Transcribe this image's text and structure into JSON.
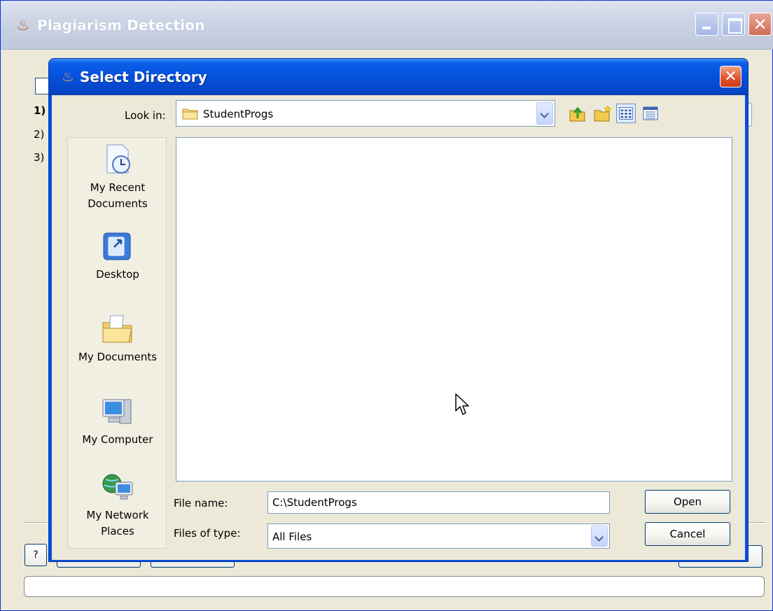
{
  "main_window": {
    "title": "Plagiarism Detection",
    "steps": [
      "1)",
      "2)",
      "3)"
    ],
    "help_label": "?"
  },
  "dialog": {
    "title": "Select Directory",
    "close_glyph": "✕",
    "look_in": {
      "label": "Look in:",
      "value": "StudentProgs"
    },
    "toolbar_icons": [
      "up-folder-icon",
      "new-folder-icon",
      "list-view-icon",
      "details-view-icon"
    ],
    "places": [
      {
        "label": "My Recent Documents",
        "line1": "My Recent",
        "line2": "Documents",
        "icon": "recent-documents-icon"
      },
      {
        "label": "Desktop",
        "icon": "desktop-icon"
      },
      {
        "label": "My Documents",
        "icon": "my-documents-icon"
      },
      {
        "label": "My Computer",
        "icon": "my-computer-icon"
      },
      {
        "label": "My Network Places",
        "line1": "My Network",
        "line2": "Places",
        "icon": "network-places-icon"
      }
    ],
    "file_name": {
      "label": "File name:",
      "value": "C:\\StudentProgs"
    },
    "files_of_type": {
      "label": "Files of type:",
      "value": "All Files"
    },
    "buttons": {
      "open": "Open",
      "cancel": "Cancel"
    }
  },
  "colors": {
    "titlebar_active": "#0550dc",
    "titlebar_inactive": "#ccd4e6",
    "dialog_bg": "#ece9d8",
    "close_button": "#e2552d"
  }
}
